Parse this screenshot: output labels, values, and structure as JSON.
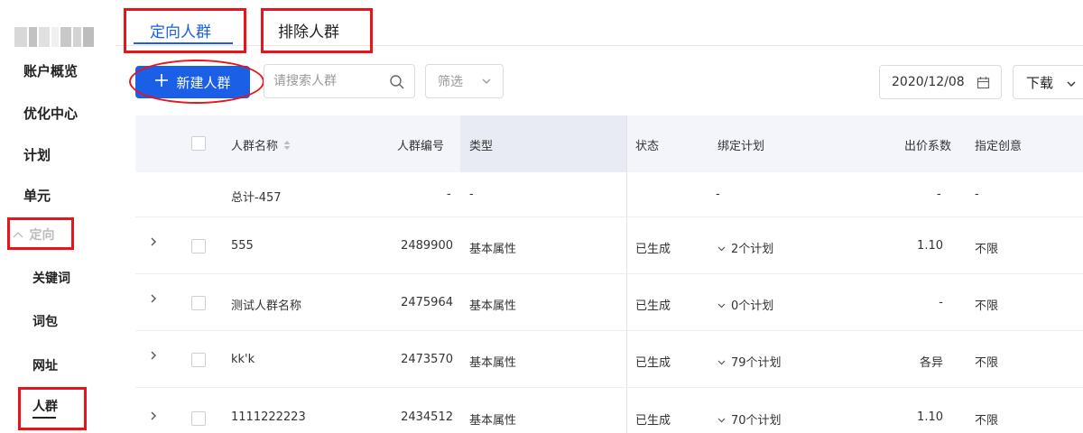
{
  "sidebar": {
    "items": [
      {
        "label": "账户概览"
      },
      {
        "label": "优化中心"
      },
      {
        "label": "计划"
      },
      {
        "label": "单元"
      }
    ],
    "group": {
      "label": "定向",
      "chevron_icon": "chevron-up-icon"
    },
    "subitems": [
      {
        "label": "关键词"
      },
      {
        "label": "词包"
      },
      {
        "label": "网址"
      },
      {
        "label": "人群"
      }
    ]
  },
  "tabs": [
    {
      "label": "定向人群"
    },
    {
      "label": "排除人群"
    }
  ],
  "toolbar": {
    "new_label": "新建人群",
    "search_placeholder": "请搜索人群",
    "filter_label": "筛选",
    "date_value": "2020/12/08",
    "download_label": "下载"
  },
  "table": {
    "headers": {
      "name": "人群名称",
      "id": "人群编号",
      "type": "类型",
      "status": "状态",
      "plan": "绑定计划",
      "bid": "出价系数",
      "creative": "指定创意"
    },
    "total": {
      "name": "总计-457",
      "id": "-",
      "type": "-",
      "plan": "-",
      "bid": "-",
      "creative": "-"
    },
    "rows": [
      {
        "name": "555",
        "id": "2489900",
        "type": "基本属性",
        "status": "已生成",
        "plan": "2个计划",
        "bid": "1.10",
        "creative": "不限"
      },
      {
        "name": "测试人群名称",
        "id": "2475964",
        "type": "基本属性",
        "status": "已生成",
        "plan": "0个计划",
        "bid": "-",
        "creative": "不限"
      },
      {
        "name": "kk'k",
        "id": "2473570",
        "type": "基本属性",
        "status": "已生成",
        "plan": "79个计划",
        "bid": "各异",
        "creative": "不限"
      },
      {
        "name": "1111222223",
        "id": "2434512",
        "type": "基本属性",
        "status": "已生成",
        "plan": "70个计划",
        "bid": "1.10",
        "creative": "不限"
      }
    ]
  },
  "colors": {
    "accent": "#1a5fe6",
    "highlight": "#e8141a"
  }
}
